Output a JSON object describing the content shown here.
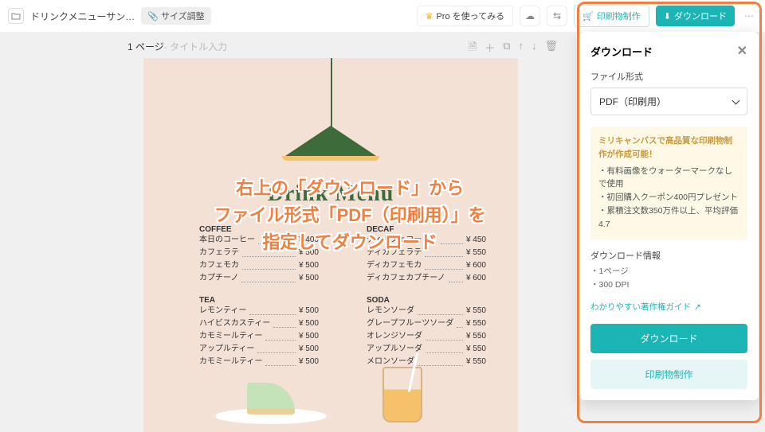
{
  "topbar": {
    "doc_title": "ドリンクメニューサン…",
    "size_chip": "サイズ調整",
    "pro_label": "Pro を使ってみる",
    "print_label": "印刷物制作",
    "download_label": "ダウンロード"
  },
  "page": {
    "number": "1 ページ",
    "title_placeholder": " - タイトル入力"
  },
  "menu": {
    "title": "Drink Menu",
    "sections": [
      {
        "heading": "COFFEE",
        "items": [
          {
            "n": "本日のコーヒー",
            "p": "¥ 400"
          },
          {
            "n": "カフェラテ",
            "p": "¥ 500"
          },
          {
            "n": "カフェモカ",
            "p": "¥ 500"
          },
          {
            "n": "カプチーノ",
            "p": "¥ 500"
          }
        ]
      },
      {
        "heading": "DECAF",
        "items": [
          {
            "n": "ディカフェコーヒー",
            "p": "¥ 450"
          },
          {
            "n": "ディカフェラテ",
            "p": "¥ 550"
          },
          {
            "n": "ディカフェモカ",
            "p": "¥ 600"
          },
          {
            "n": "ディカフェカプチーノ",
            "p": "¥ 600"
          }
        ]
      },
      {
        "heading": "TEA",
        "items": [
          {
            "n": "レモンティー",
            "p": "¥ 500"
          },
          {
            "n": "ハイビスカスティー",
            "p": "¥ 500"
          },
          {
            "n": "カモミールティー",
            "p": "¥ 500"
          },
          {
            "n": "アップルティー",
            "p": "¥ 500"
          },
          {
            "n": "カモミールティー",
            "p": "¥ 500"
          }
        ]
      },
      {
        "heading": "SODA",
        "items": [
          {
            "n": "レモンソーダ",
            "p": "¥ 550"
          },
          {
            "n": "グレープフルーツソーダ",
            "p": "¥ 550"
          },
          {
            "n": "オレンジソーダ",
            "p": "¥ 550"
          },
          {
            "n": "アップルソーダ",
            "p": "¥ 550"
          },
          {
            "n": "メロンソーダ",
            "p": "¥ 550"
          }
        ]
      }
    ]
  },
  "panel": {
    "title": "ダウンロード",
    "file_type_label": "ファイル形式",
    "file_type_value": "PDF（印刷用）",
    "promo_title": "ミリキャンバスで高品質な印刷物制作が作成可能！",
    "promo_bullets": [
      "有料画像をウォーターマークなしで使用",
      "初回購入クーポン400円プレゼント",
      "累積注文数350万件以上、平均評価4.7"
    ],
    "info_label": "ダウンロード情報",
    "info_items": [
      "1ページ",
      "300 DPI"
    ],
    "guide_link": "わかりやすい著作権ガイド",
    "download_btn": "ダウンロード",
    "print_btn": "印刷物制作"
  },
  "annotation": {
    "l1": "右上の「ダウンロード」から",
    "l2": "ファイル形式「PDF（印刷用）」を",
    "l3": "指定してダウンロード"
  }
}
